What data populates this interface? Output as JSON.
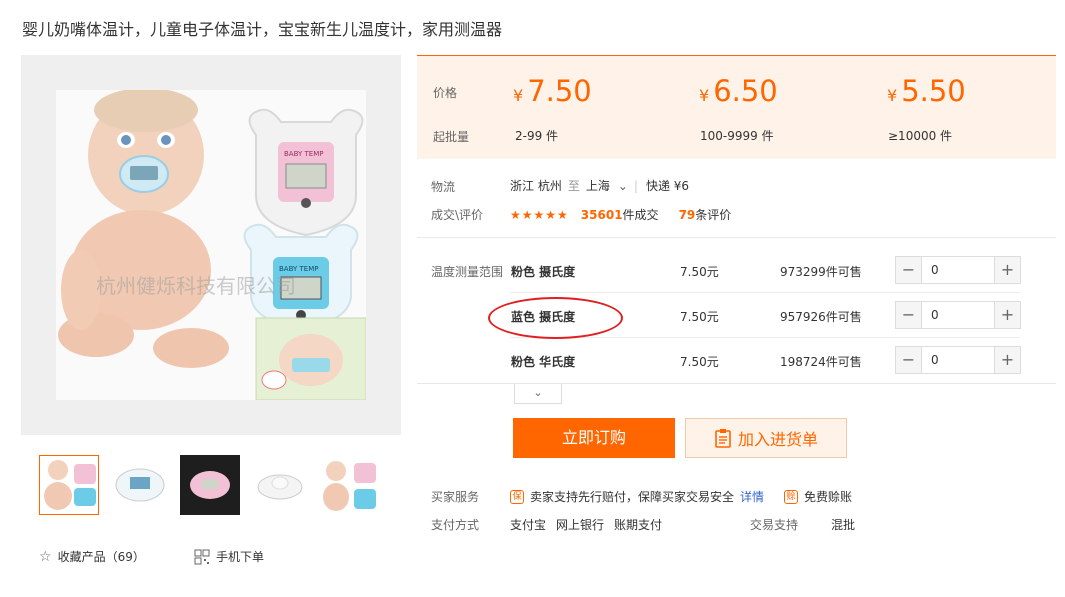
{
  "product": {
    "title": "婴儿奶嘴体温计，儿童电子体温计，宝宝新生儿温度计，家用测温器",
    "watermark": "杭州健烁科技有限公司"
  },
  "price": {
    "price_label": "价格",
    "batch_label": "起批量",
    "currency": "¥",
    "tiers": [
      {
        "price": "7.50",
        "range": "2-99 件"
      },
      {
        "price": "6.50",
        "range": "100-9999 件"
      },
      {
        "price": "5.50",
        "range": "≥10000 件"
      }
    ],
    "accent_color": "#ff6600"
  },
  "logistics": {
    "label": "物流",
    "from": "浙江 杭州",
    "to_word": "至",
    "to": "上海",
    "caret": "⌄",
    "express": "快递 ¥6"
  },
  "deals": {
    "label": "成交\\评价",
    "stars": "★★★★★",
    "rating": 4.5,
    "count": "35601",
    "count_suffix": "件成交",
    "reviews": "79",
    "reviews_suffix": "条评价"
  },
  "sku": {
    "label": "温度测量范围",
    "rows": [
      {
        "name": "粉色 摄氏度",
        "price": "7.50元",
        "stock": "973299件可售",
        "qty": "0"
      },
      {
        "name": "蓝色 摄氏度",
        "price": "7.50元",
        "stock": "957926件可售",
        "qty": "0"
      },
      {
        "name": "粉色 华氏度",
        "price": "7.50元",
        "stock": "198724件可售",
        "qty": "0"
      }
    ],
    "expand": "⌄"
  },
  "actions": {
    "buy": "立即订购",
    "cart": "加入进货单"
  },
  "service": {
    "label": "买家服务",
    "guarantee": "卖家支持先行赔付，保障买家交易安全",
    "detail": "详情",
    "free_compensation": "免费赊账"
  },
  "payment": {
    "label": "支付方式",
    "methods": [
      "支付宝",
      "网上银行",
      "账期支付"
    ],
    "trade_label": "交易支持",
    "trade_value": "混批"
  },
  "bottom": {
    "favorite": "收藏产品（69）",
    "mobile": "手机下单"
  }
}
